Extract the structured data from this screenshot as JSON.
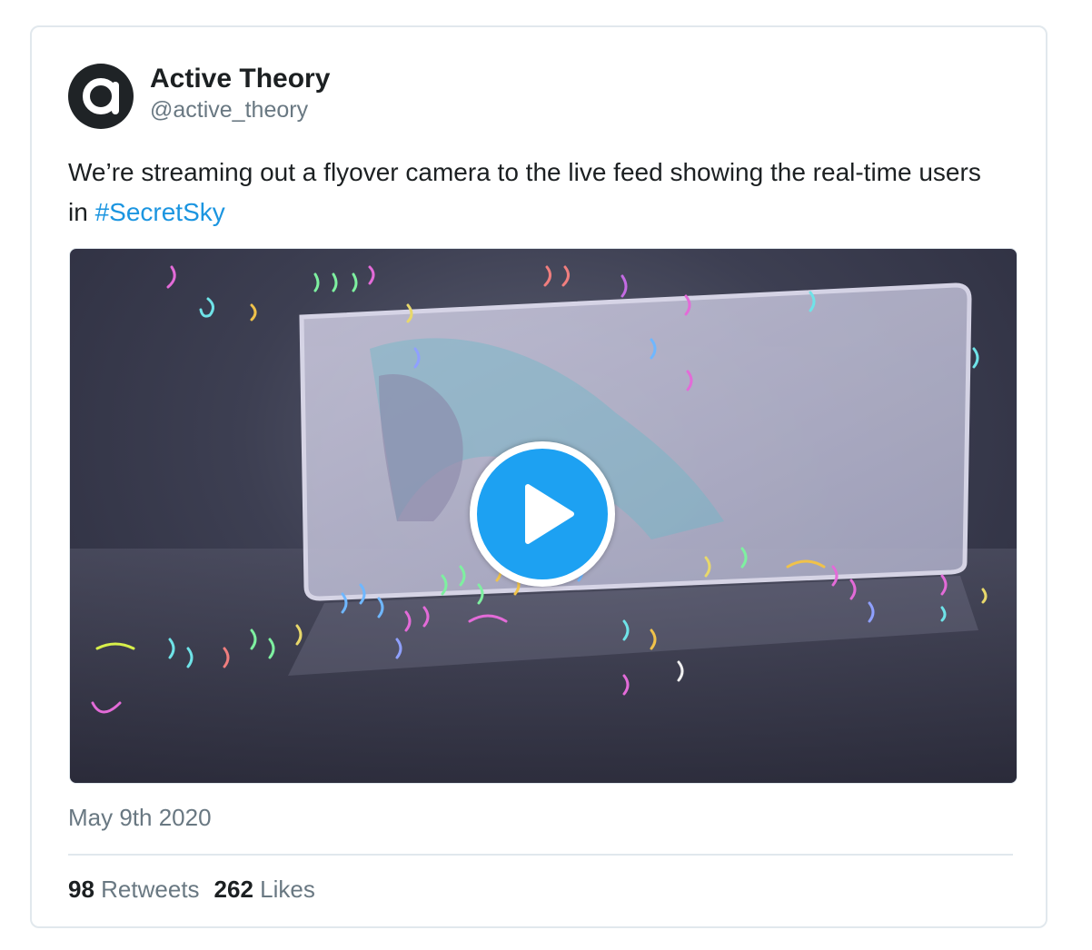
{
  "tweet": {
    "author": {
      "display_name": "Active Theory",
      "handle": "@active_theory",
      "avatar_icon": "active-theory-logo"
    },
    "text_before_hashtag": "We’re streaming out a flyover camera to the live feed showing the real-time users in ",
    "hashtag": "#SecretSky",
    "media": {
      "type": "video",
      "play_icon": "play-icon"
    },
    "date": "May 9th 2020",
    "stats": {
      "retweets_count": "98",
      "retweets_label": "Retweets",
      "likes_count": "262",
      "likes_label": "Likes"
    }
  },
  "colors": {
    "accent": "#1da1f2",
    "hashtag": "#1b95e0",
    "secondary_text": "#697882",
    "border": "#e1e8ed"
  }
}
